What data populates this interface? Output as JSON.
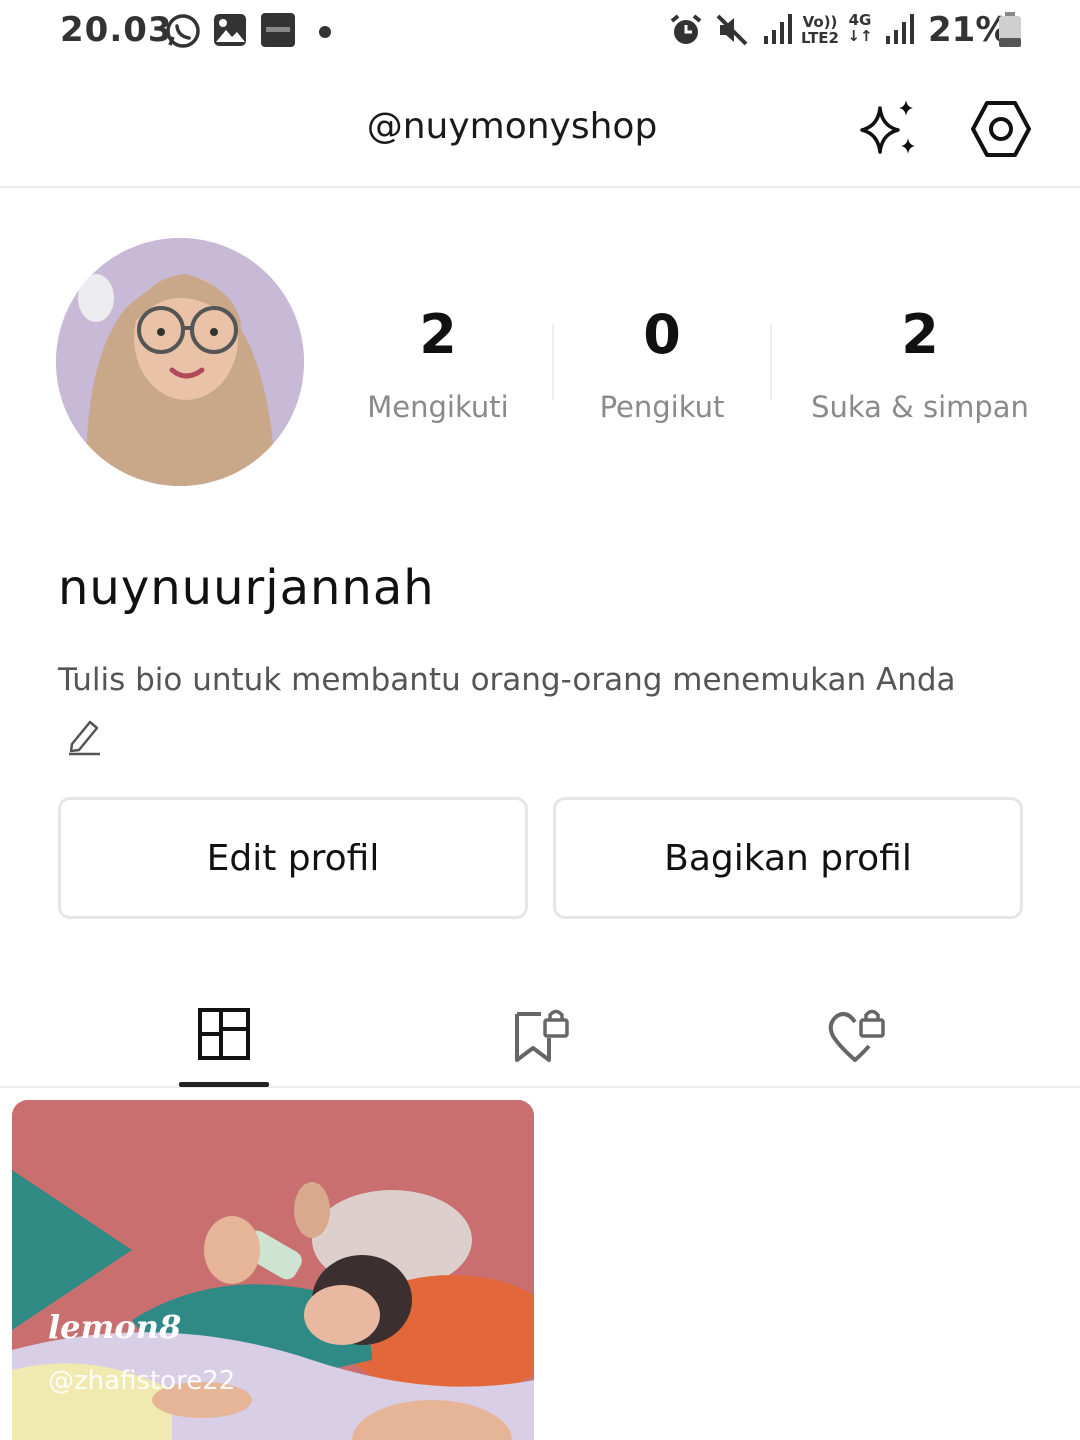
{
  "status_bar": {
    "time": "20.03",
    "battery": "21%",
    "volte_top": "Vo))",
    "volte_bottom": "LTE2",
    "network_type": "4G",
    "icons": [
      "whatsapp-icon",
      "gallery-icon",
      "lemon8-app-icon",
      "notification-dot",
      "alarm-icon",
      "mute-icon",
      "signal-icon",
      "volte-icon",
      "data-arrows-icon",
      "signal-icon",
      "battery-icon"
    ]
  },
  "header": {
    "username": "@nuymonyshop",
    "icons": [
      "sparkle-icon",
      "settings-icon"
    ]
  },
  "profile": {
    "stats": [
      {
        "value": "2",
        "label": "Mengikuti"
      },
      {
        "value": "0",
        "label": "Pengikut"
      },
      {
        "value": "2",
        "label": "Suka & simpan"
      }
    ],
    "display_name": "nuynuurjannah",
    "bio_placeholder": "Tulis bio untuk membantu orang-orang menemukan Anda"
  },
  "buttons": {
    "edit_profile": "Edit profil",
    "share_profile": "Bagikan profil"
  },
  "tabs": [
    {
      "icon": "grid-icon",
      "active": true
    },
    {
      "icon": "bookmark-lock-icon",
      "active": false
    },
    {
      "icon": "heart-lock-icon",
      "active": false
    }
  ],
  "posts": [
    {
      "watermark": "lemon8",
      "handle": "@zhafistore22"
    }
  ],
  "colors": {
    "background": "#ffffff",
    "text_primary": "#111111",
    "text_secondary": "#8a8a8a",
    "border": "#e6e6e6",
    "avatar_bg": "#c8b9d6",
    "post_bg": "#c96f6f"
  }
}
